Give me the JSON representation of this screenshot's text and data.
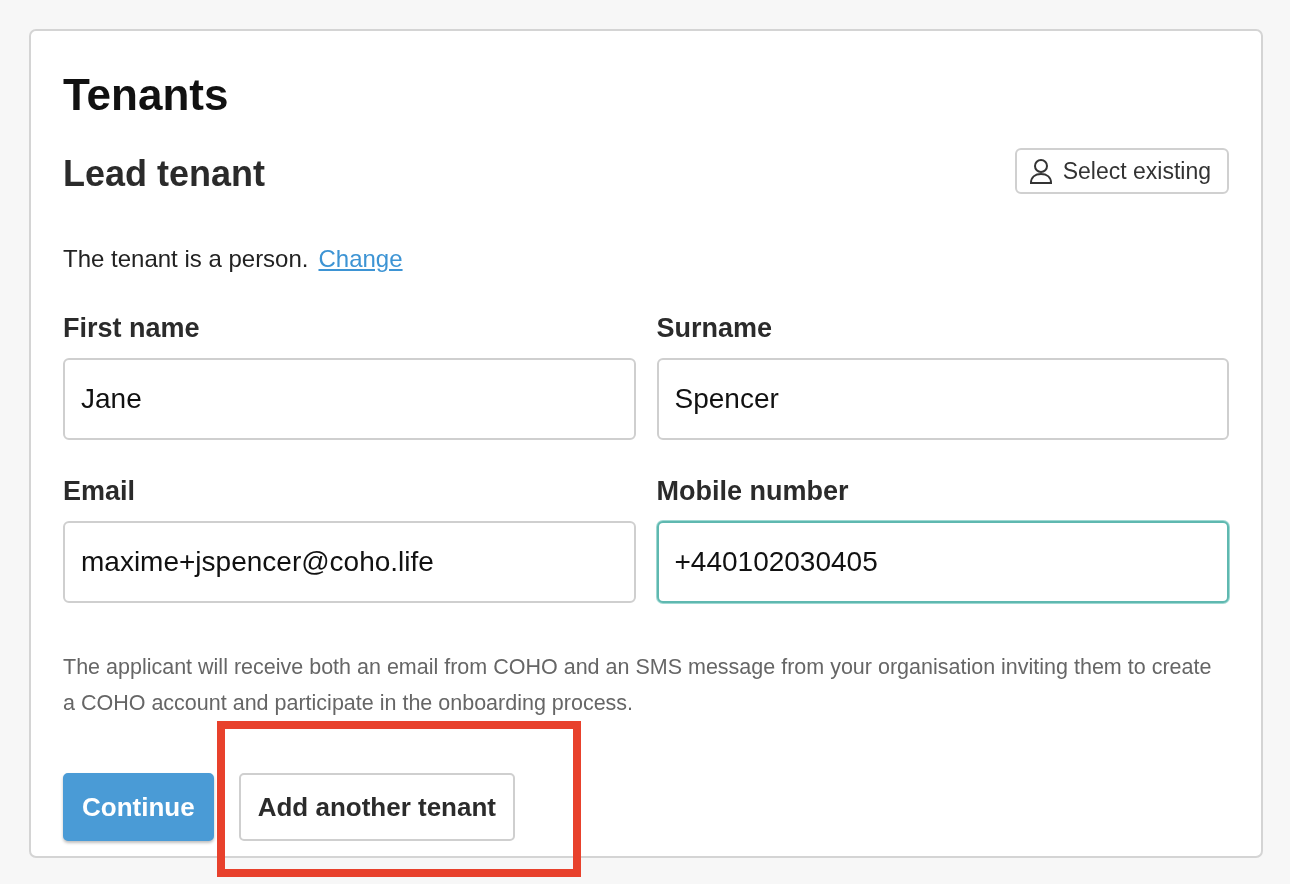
{
  "title": "Tenants",
  "section": {
    "title": "Lead tenant",
    "select_button": "Select existing"
  },
  "tenant_type": {
    "text": "The tenant is a person.",
    "link": "Change"
  },
  "fields": [
    {
      "label": "First name",
      "value": "Jane",
      "focused": false
    },
    {
      "label": "Surname",
      "value": "Spencer",
      "focused": false
    },
    {
      "label": "Email",
      "value": "maxime+jspencer@coho.life",
      "focused": false
    },
    {
      "label": "Mobile number",
      "value": "+440102030405",
      "focused": true
    }
  ],
  "helper_text": "The applicant will receive both an email from COHO and an SMS message from your organisation inviting them to create a COHO account and participate in the onboarding process.",
  "buttons": [
    {
      "label": "Continue",
      "kind": "primary"
    },
    {
      "label": "Add another tenant",
      "kind": "secondary"
    }
  ],
  "highlight": {
    "on": true
  }
}
